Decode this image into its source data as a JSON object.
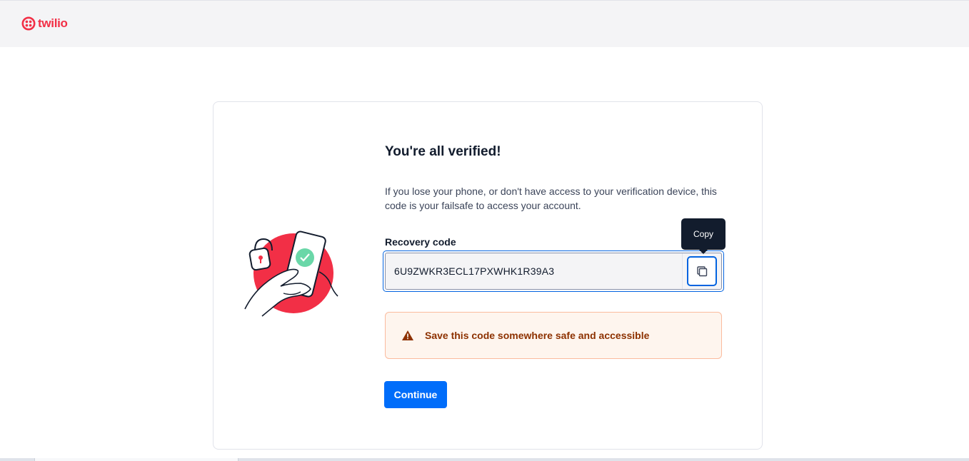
{
  "brand": {
    "name": "twilio",
    "color": "#f22f46"
  },
  "card": {
    "title": "You're all verified!",
    "description": "If you lose your phone, or don't have access to your verification device, this code is your failsafe to access your account.",
    "recovery_label": "Recovery code",
    "recovery_code": "6U9ZWKR3ECL17PXWHK1R39A3",
    "copy_icon": "copy-icon",
    "tooltip": "Copy",
    "warning": {
      "icon": "warning-triangle-icon",
      "text": "Save this code somewhere safe and accessible"
    },
    "continue_label": "Continue"
  },
  "colors": {
    "primary": "#006dfa",
    "warning_bg": "#fef5ee",
    "warning_text": "#8d3100",
    "illustration_red": "#f22f46",
    "check_green": "#6ad7a8"
  }
}
